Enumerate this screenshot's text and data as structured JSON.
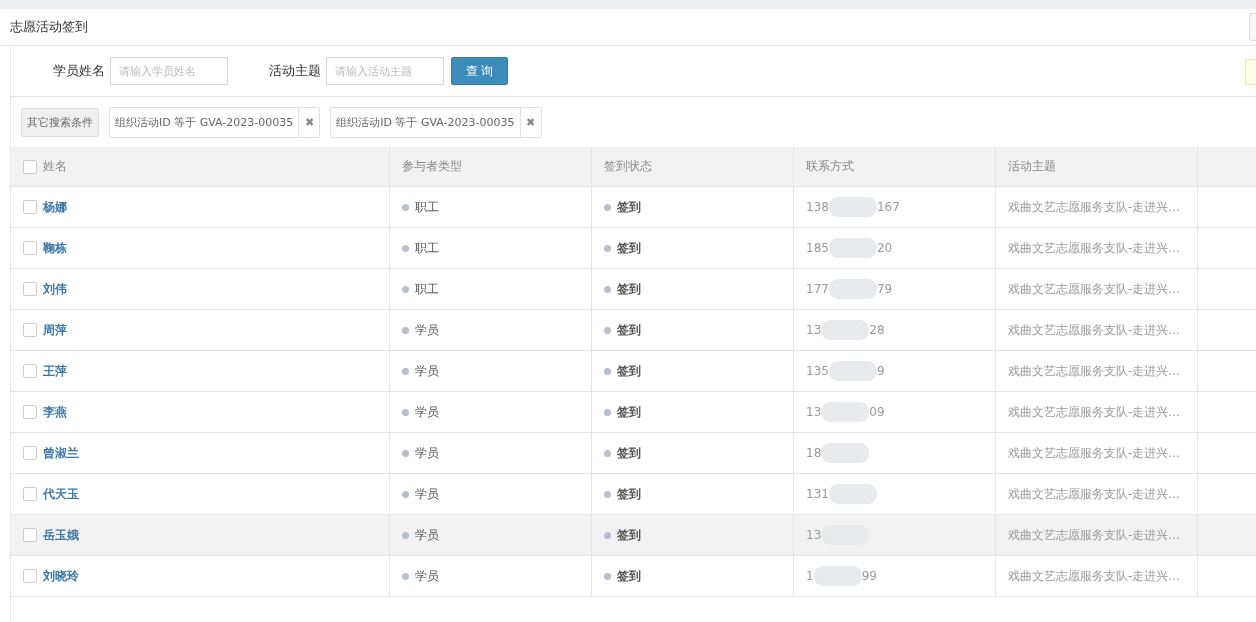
{
  "page_title": "志愿活动签到",
  "search": {
    "fields": [
      {
        "label": "学员姓名",
        "placeholder": "请输入学员姓名"
      },
      {
        "label": "活动主题",
        "placeholder": "请输入活动主题"
      }
    ],
    "button": "查 询"
  },
  "filters": {
    "more_button": "其它搜索条件",
    "tags": [
      {
        "text": "组织活动ID 等于 GVA-2023-00035",
        "close": "✖"
      },
      {
        "text": "组织活动ID 等于 GVA-2023-00035",
        "close": "✖"
      }
    ]
  },
  "table": {
    "all_checked": false,
    "columns": [
      "姓名",
      "参与者类型",
      "签到状态",
      "联系方式",
      "活动主题"
    ],
    "rows": [
      {
        "checked": false,
        "highlighted": false,
        "name": "杨娜",
        "type": "职工",
        "status": "签到",
        "phone_start": "138",
        "phone_end": "167",
        "topic": "戏曲文艺志愿服务支队-走进兴..."
      },
      {
        "checked": false,
        "highlighted": false,
        "name": "鞠栋",
        "type": "职工",
        "status": "签到",
        "phone_start": "185",
        "phone_end": "20",
        "topic": "戏曲文艺志愿服务支队-走进兴..."
      },
      {
        "checked": false,
        "highlighted": false,
        "name": "刘伟",
        "type": "职工",
        "status": "签到",
        "phone_start": "177",
        "phone_end": "79",
        "topic": "戏曲文艺志愿服务支队-走进兴..."
      },
      {
        "checked": false,
        "highlighted": false,
        "name": "周萍",
        "type": "学员",
        "status": "签到",
        "phone_start": "13",
        "phone_end": "28",
        "topic": "戏曲文艺志愿服务支队-走进兴..."
      },
      {
        "checked": false,
        "highlighted": false,
        "name": "王萍",
        "type": "学员",
        "status": "签到",
        "phone_start": "135",
        "phone_end": "9",
        "topic": "戏曲文艺志愿服务支队-走进兴..."
      },
      {
        "checked": false,
        "highlighted": false,
        "name": "李燕",
        "type": "学员",
        "status": "签到",
        "phone_start": "13",
        "phone_end": "09",
        "topic": "戏曲文艺志愿服务支队-走进兴..."
      },
      {
        "checked": false,
        "highlighted": false,
        "name": "曾淑兰",
        "type": "学员",
        "status": "签到",
        "phone_start": "18",
        "topic": "戏曲文艺志愿服务支队-走进兴..."
      },
      {
        "checked": false,
        "highlighted": false,
        "name": "代天玉",
        "type": "学员",
        "status": "签到",
        "phone_start": "131",
        "topic": "戏曲文艺志愿服务支队-走进兴..."
      },
      {
        "checked": false,
        "highlighted": true,
        "name": "岳玉娥",
        "type": "学员",
        "status": "签到",
        "phone_start": "13",
        "topic": "戏曲文艺志愿服务支队-走进兴..."
      },
      {
        "checked": false,
        "highlighted": false,
        "name": "刘晓玲",
        "type": "学员",
        "status": "签到",
        "phone_start": "1",
        "phone_end": "99",
        "topic": "戏曲文艺志愿服务支队-走进兴..."
      }
    ]
  }
}
